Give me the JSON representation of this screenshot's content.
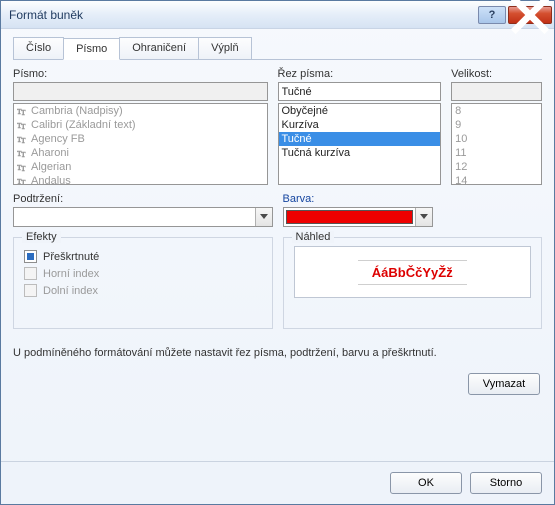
{
  "window": {
    "title": "Formát buněk"
  },
  "tabs": {
    "number": "Číslo",
    "font": "Písmo",
    "border": "Ohraničení",
    "fill": "Výplň"
  },
  "labels": {
    "font": "Písmo:",
    "style": "Řez písma:",
    "size": "Velikost:",
    "underline": "Podtržení:",
    "color": "Barva:"
  },
  "font_input": "",
  "style_input": "Tučné",
  "size_input": "",
  "fonts": [
    "Cambria (Nadpisy)",
    "Calibri (Základní text)",
    "Agency FB",
    "Aharoni",
    "Algerian",
    "Andalus"
  ],
  "styles": [
    "Obyčejné",
    "Kurzíva",
    "Tučné",
    "Tučná kurzíva"
  ],
  "sizes": [
    "8",
    "9",
    "10",
    "11",
    "12",
    "14"
  ],
  "underline_value": "",
  "color_value": "#ee0000",
  "effects": {
    "legend": "Efekty",
    "strike": "Přeškrtnuté",
    "sup": "Horní index",
    "sub": "Dolní index"
  },
  "preview": {
    "legend": "Náhled",
    "sample": "ÁáBbČčYyŽž"
  },
  "hint": "U podmíněného formátování můžete nastavit řez písma, podtržení, barvu a přeškrtnutí.",
  "buttons": {
    "clear": "Vymazat",
    "ok": "OK",
    "cancel": "Storno"
  }
}
